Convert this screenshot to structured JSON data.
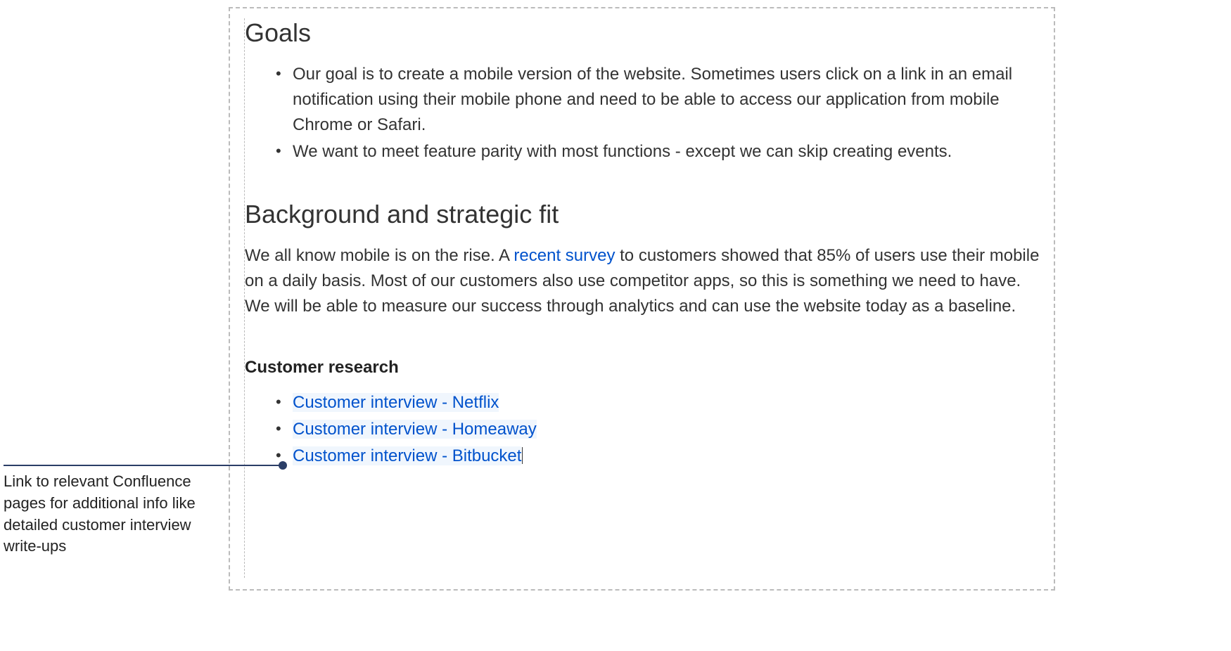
{
  "headings": {
    "goals": "Goals",
    "background": "Background and strategic fit",
    "customer_research": "Customer research"
  },
  "goals_list": [
    "Our goal is to create a mobile version of the website. Sometimes users click on a link in an email notification using their mobile phone and need to be able to access our application from mobile Chrome or Safari.",
    "We want to meet feature parity with most functions - except we can skip creating events."
  ],
  "background": {
    "text_before_link": "We all know mobile is on the rise. A ",
    "link_text": "recent survey",
    "text_after_link": " to customers showed that 85% of users use their mobile on a daily basis. Most of our customers also use competitor apps, so this is something we need to have. We will be able to measure our success through analytics and can use the website today as a baseline."
  },
  "customer_research_links": [
    "Customer interview - Netflix",
    "Customer interview - Homeaway",
    "Customer interview - Bitbucket"
  ],
  "annotation": "Link to relevant Confluence pages for additional info like detailed customer interview write-ups",
  "colors": {
    "link": "#0052cc",
    "text": "#333333",
    "border": "#bbbbbb",
    "connector": "#2a3d66"
  }
}
